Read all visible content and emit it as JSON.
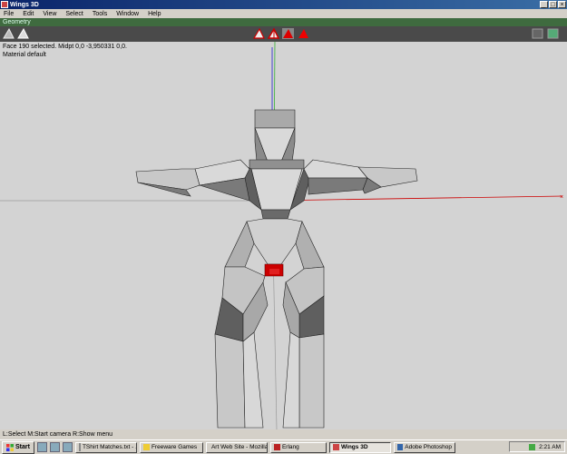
{
  "window": {
    "title": "Wings 3D"
  },
  "menu": [
    "File",
    "Edit",
    "View",
    "Select",
    "Tools",
    "Window",
    "Help"
  ],
  "geometry_bar": "Geometry",
  "info": {
    "line1": "Face 190 selected. Midpt 0,0 -3,950331 0,0.",
    "line2": "Material default"
  },
  "statusbar": {
    "text": "L:Select   M:Start camera   R:Show menu"
  },
  "taskbar": {
    "start": "Start",
    "tasks": [
      {
        "label": "TShirt Matches.txt - ..."
      },
      {
        "label": "Freeware Games"
      },
      {
        "label": "Art Web Site - Mozilla"
      },
      {
        "label": "Erlang"
      },
      {
        "label": "Wings 3D"
      },
      {
        "label": "Adobe Photoshop"
      }
    ],
    "clock": "2:21 AM"
  },
  "colors": {
    "selection": "#cc0000",
    "axis_x": "#cc0000",
    "axis_y": "#22aa22",
    "axis_z": "#2222cc"
  }
}
